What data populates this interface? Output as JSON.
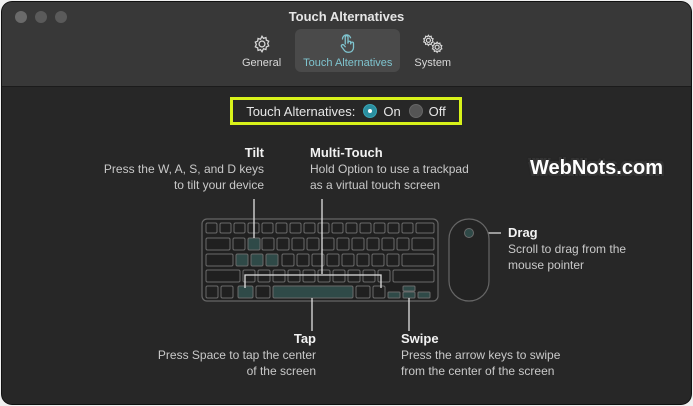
{
  "window": {
    "title": "Touch Alternatives"
  },
  "tabs": [
    {
      "label": "General",
      "icon": "gear-icon",
      "active": false
    },
    {
      "label": "Touch Alternatives",
      "icon": "hand-pointer-icon",
      "active": true
    },
    {
      "label": "System",
      "icon": "gears-icon",
      "active": false
    }
  ],
  "toggle": {
    "label": "Touch Alternatives:",
    "on_label": "On",
    "off_label": "Off",
    "selected": "On"
  },
  "tilt": {
    "title": "Tilt",
    "line1": "Press the W, A, S, and D keys",
    "line2": "to tilt your device"
  },
  "multitouch": {
    "title": "Multi-Touch",
    "line1": "Hold Option to use a trackpad",
    "line2": "as a virtual touch screen"
  },
  "drag": {
    "title": "Drag",
    "line1": "Scroll to drag from the",
    "line2": "mouse pointer"
  },
  "tap": {
    "title": "Tap",
    "line1": "Press Space to tap the center",
    "line2": "of the screen"
  },
  "swipe": {
    "title": "Swipe",
    "line1": "Press the arrow keys to swipe",
    "line2": "from the center of the screen"
  },
  "watermark": "WebNots.com",
  "colors": {
    "accent": "#2a8fa0",
    "highlight_box": "#d8f21a",
    "active_tab_text": "#7fc4cf"
  }
}
